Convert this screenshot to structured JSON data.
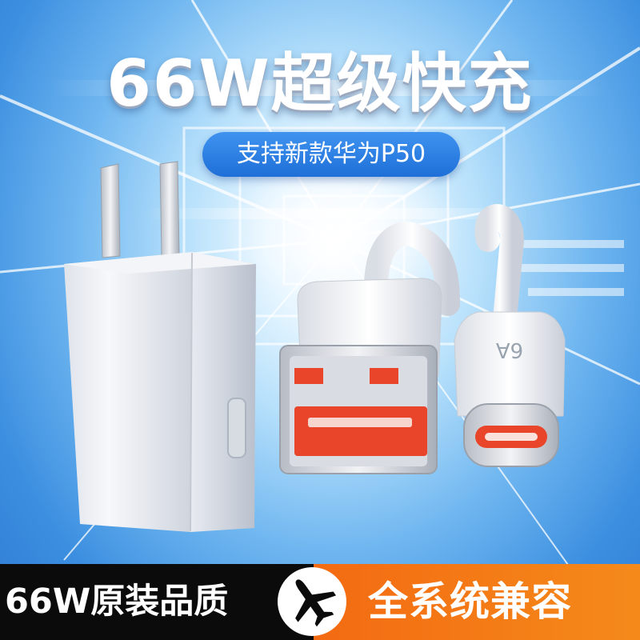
{
  "headline": "66W超级快充",
  "subheadline": "支持新款华为P50",
  "footer": {
    "left_text": "66W原装品质",
    "right_text": "全系统兼容",
    "plane_icon": "airplane-icon"
  },
  "cable_marking": "6A",
  "colors": {
    "accent_blue": "#1f6fd8",
    "footer_orange": "#f36a12",
    "footer_black": "#0b0b0b",
    "connector_red": "#e8452a"
  }
}
